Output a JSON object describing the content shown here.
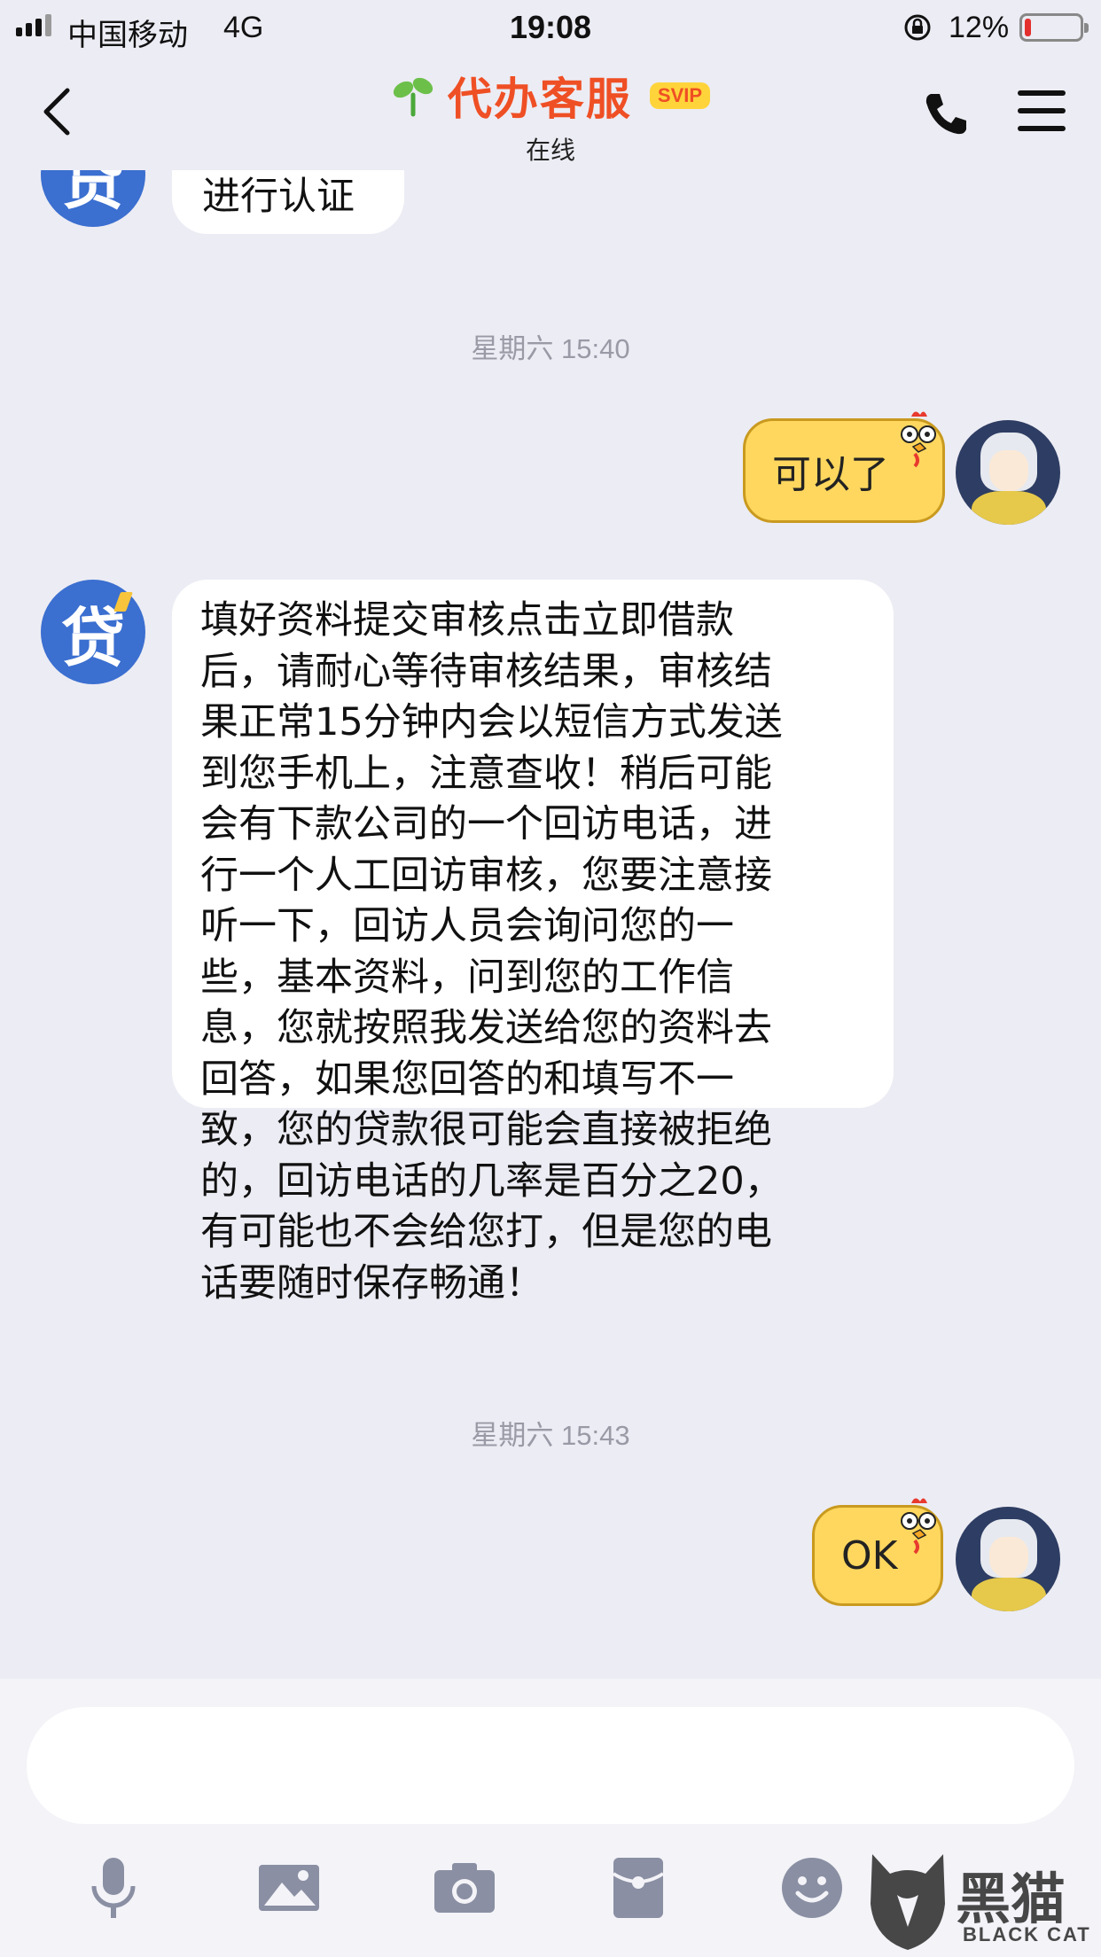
{
  "status_bar": {
    "carrier": "中国移动",
    "network": "4G",
    "time": "19:08",
    "battery_percent": "12%",
    "battery_level": 0.12,
    "battery_color": "#e3302f"
  },
  "header": {
    "title": "代办客服",
    "badge": "SVIP",
    "status": "在线",
    "title_color": "#ef4f24",
    "badge_color": "#ffd43b"
  },
  "messages": [
    {
      "from": "bot",
      "text": "进行认证",
      "partial": true
    },
    {
      "type": "timestamp",
      "text": "星期六 15:40"
    },
    {
      "from": "me",
      "text": "可以了"
    },
    {
      "from": "bot",
      "lines": [
        "填好资料提交审核点击立即借款",
        "后，请耐心等待审核结果，审核结",
        "果正常15分钟内会以短信方式发送",
        "到您手机上，注意查收！稍后可能",
        "会有下款公司的一个回访电话，进",
        "行一个人工回访审核，您要注意接",
        "听一下，回访人员会询问您的一",
        "些，基本资料，问到您的工作信",
        "息，您就按照我发送给您的资料去",
        "回答，如果您回答的和填写不一",
        "致，您的贷款很可能会直接被拒绝",
        "的，回访电话的几率是百分之20，",
        "有可能也不会给您打，但是您的电",
        "话要随时保存畅通！"
      ]
    },
    {
      "type": "timestamp",
      "text": "星期六 15:43"
    },
    {
      "from": "me",
      "text": "OK"
    }
  ],
  "bot_avatar_char": "贷",
  "input": {
    "value": ""
  },
  "toolbar": [
    "microphone-icon",
    "image-icon",
    "camera-icon",
    "red-packet-icon",
    "emoji-icon"
  ],
  "watermark": {
    "text": "黑猫",
    "sub": "BLACK CAT"
  }
}
